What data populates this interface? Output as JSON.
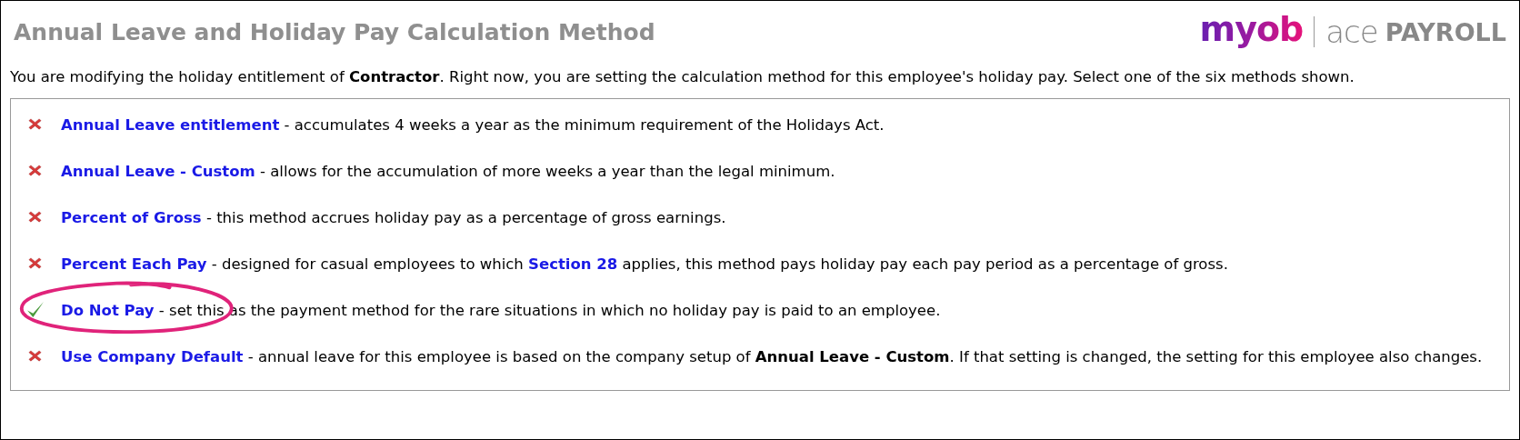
{
  "header": {
    "title": "Annual Leave and Holiday Pay Calculation Method",
    "logo": {
      "brand": "myob",
      "product_light": "ace",
      "product_bold": "PAYROLL"
    }
  },
  "intro": "You are modifying the holiday entitlement of **Contractor**. Right now, you are setting the calculation method for this employee's holiday pay. Select one of the six methods shown.",
  "methods": [
    {
      "name": "Annual Leave entitlement",
      "selected": false,
      "description": [
        {
          "kind": "text",
          "text": " - accumulates 4 weeks a year as the minimum requirement of the Holidays Act."
        }
      ]
    },
    {
      "name": "Annual Leave - Custom",
      "selected": false,
      "description": [
        {
          "kind": "text",
          "text": " - allows for the accumulation of more weeks a year than the legal minimum."
        }
      ]
    },
    {
      "name": "Percent of Gross",
      "selected": false,
      "description": [
        {
          "kind": "text",
          "text": " - this method accrues holiday pay as a percentage of gross earnings."
        }
      ]
    },
    {
      "name": "Percent Each Pay",
      "selected": false,
      "description": [
        {
          "kind": "text",
          "text": " - designed for casual employees to which "
        },
        {
          "kind": "link",
          "text": "Section 28"
        },
        {
          "kind": "text",
          "text": " applies, this method pays holiday pay each pay period as a percentage of gross."
        }
      ]
    },
    {
      "name": "Do Not Pay",
      "selected": true,
      "highlighted": true,
      "description": [
        {
          "kind": "text",
          "text": " - set this as the payment method for the rare situations in which no holiday pay is paid to an employee."
        }
      ]
    },
    {
      "name": "Use Company Default",
      "selected": false,
      "description": [
        {
          "kind": "text",
          "text": " - annual leave for this employee is based on the company setup of "
        },
        {
          "kind": "bold",
          "text": "Annual Leave - Custom"
        },
        {
          "kind": "text",
          "text": ". If that setting is changed, the setting for this employee also changes."
        }
      ]
    }
  ]
}
